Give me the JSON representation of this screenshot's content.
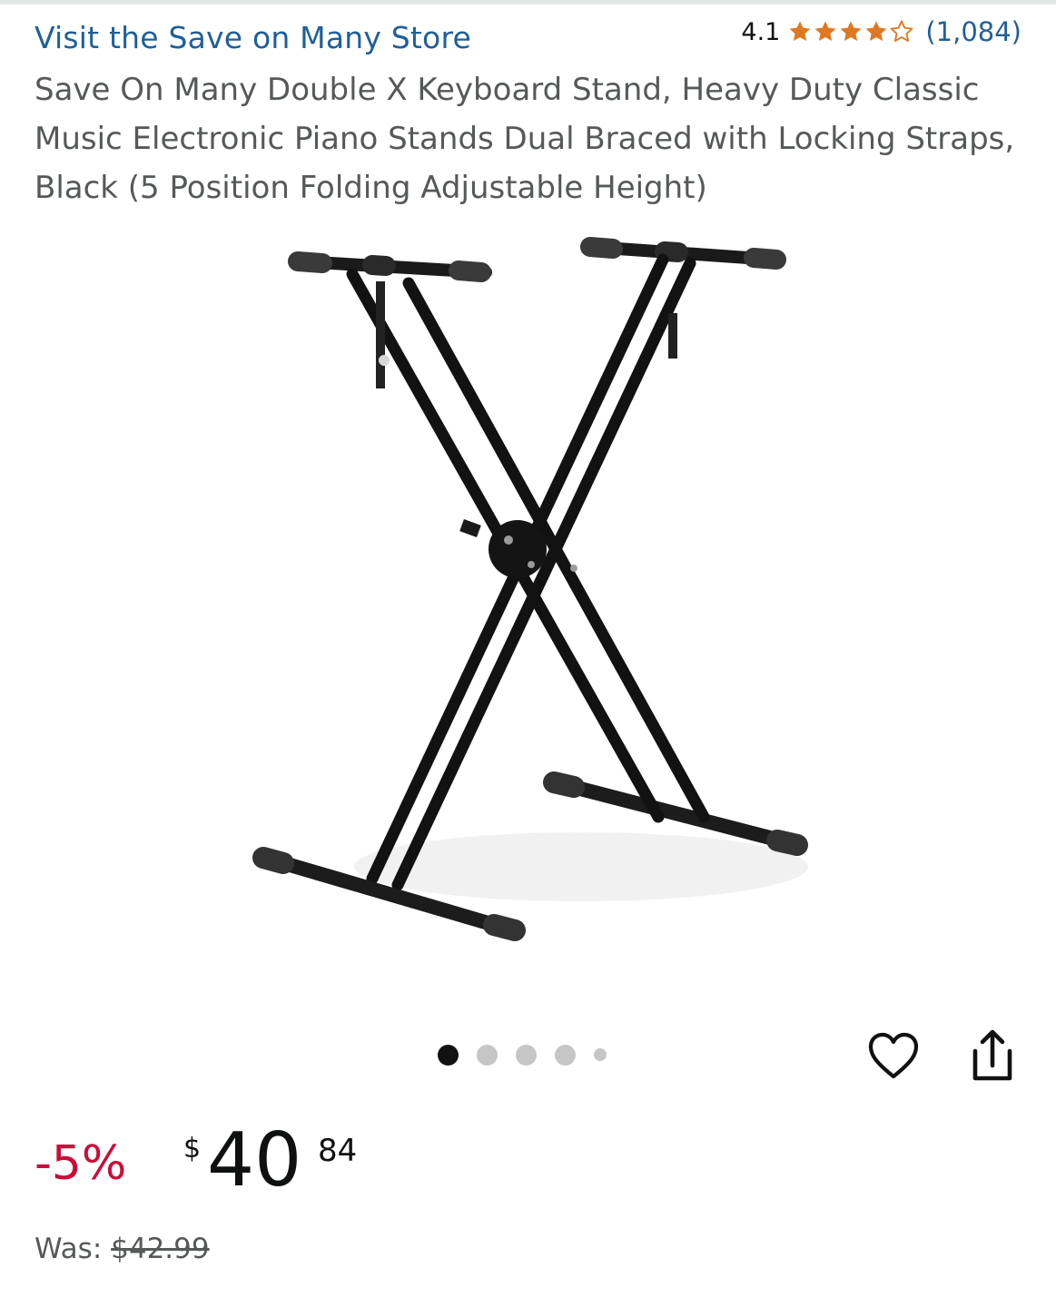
{
  "store": {
    "link_text": "Visit the Save on Many Store"
  },
  "rating": {
    "value": "4.1",
    "stars": 4.1,
    "max_stars": 5,
    "count": "(1,084)",
    "star_color": "#de7921"
  },
  "product": {
    "title": "Save On Many Double X Keyboard Stand, Heavy Duty Classic Music Electronic Piano Stands Dual Braced with Locking Straps, Black (5 Position Folding Adjustable Height)"
  },
  "carousel": {
    "total_images": 5,
    "active_index": 0
  },
  "icons": {
    "wishlist": "heart-icon",
    "share": "share-icon"
  },
  "price": {
    "discount": "-5%",
    "currency": "$",
    "whole": "40",
    "fraction": "84",
    "was_label": "Was:",
    "was_value": "$42.99",
    "discount_color": "#cc0c39"
  }
}
